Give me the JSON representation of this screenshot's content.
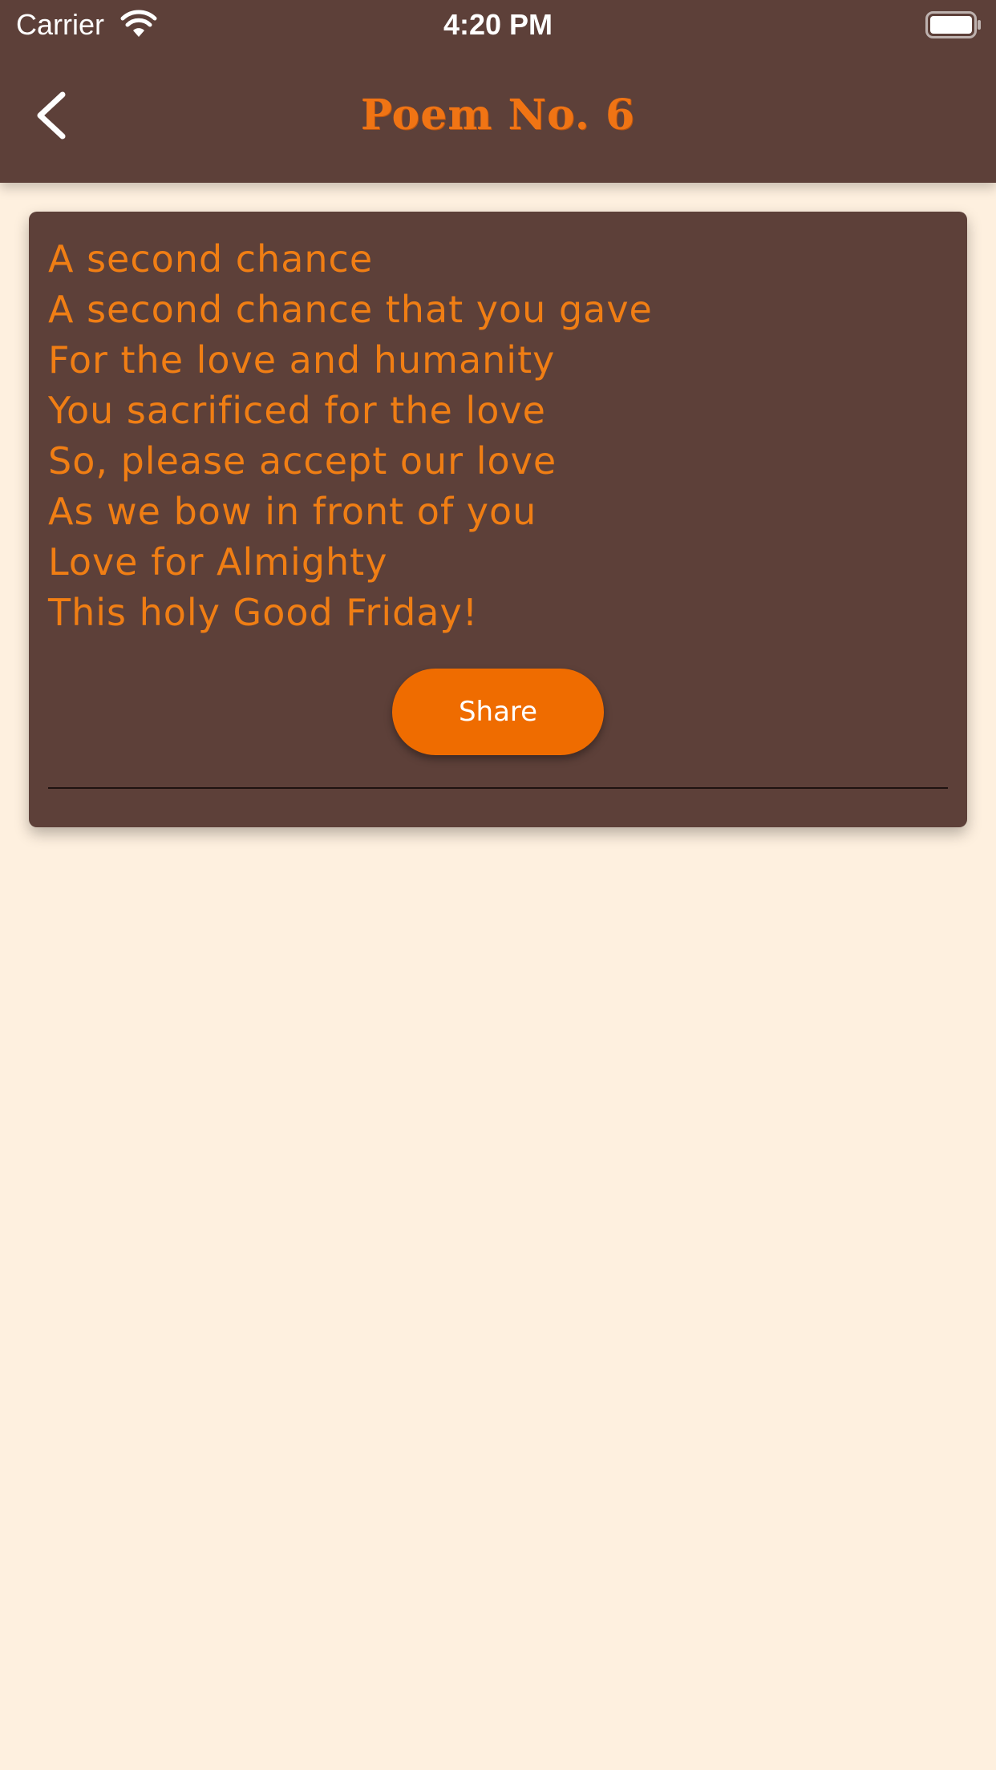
{
  "status_bar": {
    "carrier": "Carrier",
    "time": "4:20 PM",
    "wifi_icon": "wifi-icon",
    "battery_icon": "battery-full-icon"
  },
  "header": {
    "title": "Poem No. 6",
    "back_icon": "chevron-left-icon",
    "background_color": "#5D4039",
    "title_color": "#F07414"
  },
  "poem": {
    "lines": [
      "A second chance",
      "A second chance that you gave",
      "For the love and humanity",
      "You sacrificed for the love",
      "So, please accept our love",
      "As we bow in front of you",
      "Love for Almighty",
      "This holy Good Friday!"
    ],
    "text_color": "#F07E14",
    "card_color": "#5D4039"
  },
  "actions": {
    "share_label": "Share",
    "share_color": "#EF6C00"
  },
  "page": {
    "background_color": "#FEF0DF"
  }
}
